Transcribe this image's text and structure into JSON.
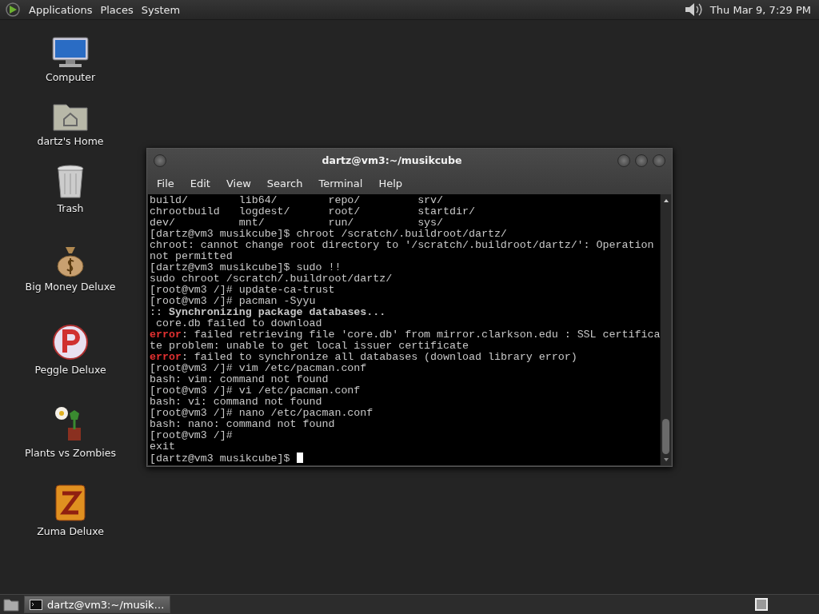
{
  "top_panel": {
    "menus": [
      "Applications",
      "Places",
      "System"
    ],
    "clock": "Thu Mar 9, 7:29 PM"
  },
  "desktop_icons": [
    {
      "label": "Computer",
      "kind": "computer"
    },
    {
      "label": "dartz's Home",
      "kind": "home"
    },
    {
      "label": "Trash",
      "kind": "trash"
    },
    {
      "label": "Big Money Deluxe",
      "kind": "moneybag"
    },
    {
      "label": "Peggle Deluxe",
      "kind": "ball"
    },
    {
      "label": "Plants vs Zombies",
      "kind": "flower"
    },
    {
      "label": "Zuma Deluxe",
      "kind": "zuma"
    }
  ],
  "terminal_window": {
    "title": "dartz@vm3:~/musikcube",
    "menu": [
      "File",
      "Edit",
      "View",
      "Search",
      "Terminal",
      "Help"
    ],
    "lines": [
      {
        "kind": "plain",
        "text": "build/        lib64/        repo/         srv/"
      },
      {
        "kind": "plain",
        "text": "chrootbuild   logdest/      root/         startdir/"
      },
      {
        "kind": "plain",
        "text": "dev/          mnt/          run/          sys/"
      },
      {
        "kind": "plain",
        "text": "[dartz@vm3 musikcube]$ chroot /scratch/.buildroot/dartz/"
      },
      {
        "kind": "plain",
        "text": "chroot: cannot change root directory to '/scratch/.buildroot/dartz/': Operation"
      },
      {
        "kind": "plain",
        "text": "not permitted"
      },
      {
        "kind": "plain",
        "text": "[dartz@vm3 musikcube]$ sudo !!"
      },
      {
        "kind": "plain",
        "text": "sudo chroot /scratch/.buildroot/dartz/"
      },
      {
        "kind": "plain",
        "text": "[root@vm3 /]# update-ca-trust"
      },
      {
        "kind": "plain",
        "text": "[root@vm3 /]# pacman -Syyu"
      },
      {
        "kind": "plain",
        "text": ":: **Synchronizing package databases...**"
      },
      {
        "kind": "plain",
        "text": " core.db failed to download"
      },
      {
        "kind": "error",
        "prefix": "error",
        "text": ": failed retrieving file 'core.db' from mirror.clarkson.edu : SSL certifica"
      },
      {
        "kind": "plain",
        "text": "te problem: unable to get local issuer certificate"
      },
      {
        "kind": "error",
        "prefix": "error",
        "text": ": failed to synchronize all databases (download library error)"
      },
      {
        "kind": "plain",
        "text": "[root@vm3 /]# vim /etc/pacman.conf"
      },
      {
        "kind": "plain",
        "text": "bash: vim: command not found"
      },
      {
        "kind": "plain",
        "text": "[root@vm3 /]# vi /etc/pacman.conf"
      },
      {
        "kind": "plain",
        "text": "bash: vi: command not found"
      },
      {
        "kind": "plain",
        "text": "[root@vm3 /]# nano /etc/pacman.conf"
      },
      {
        "kind": "plain",
        "text": "bash: nano: command not found"
      },
      {
        "kind": "plain",
        "text": "[root@vm3 /]#"
      },
      {
        "kind": "plain",
        "text": "exit"
      },
      {
        "kind": "plain",
        "text": "[dartz@vm3 musikcube]$ "
      }
    ]
  },
  "taskbar": {
    "tasks": [
      {
        "label": "dartz@vm3:~/musik…",
        "selected": true
      }
    ]
  }
}
